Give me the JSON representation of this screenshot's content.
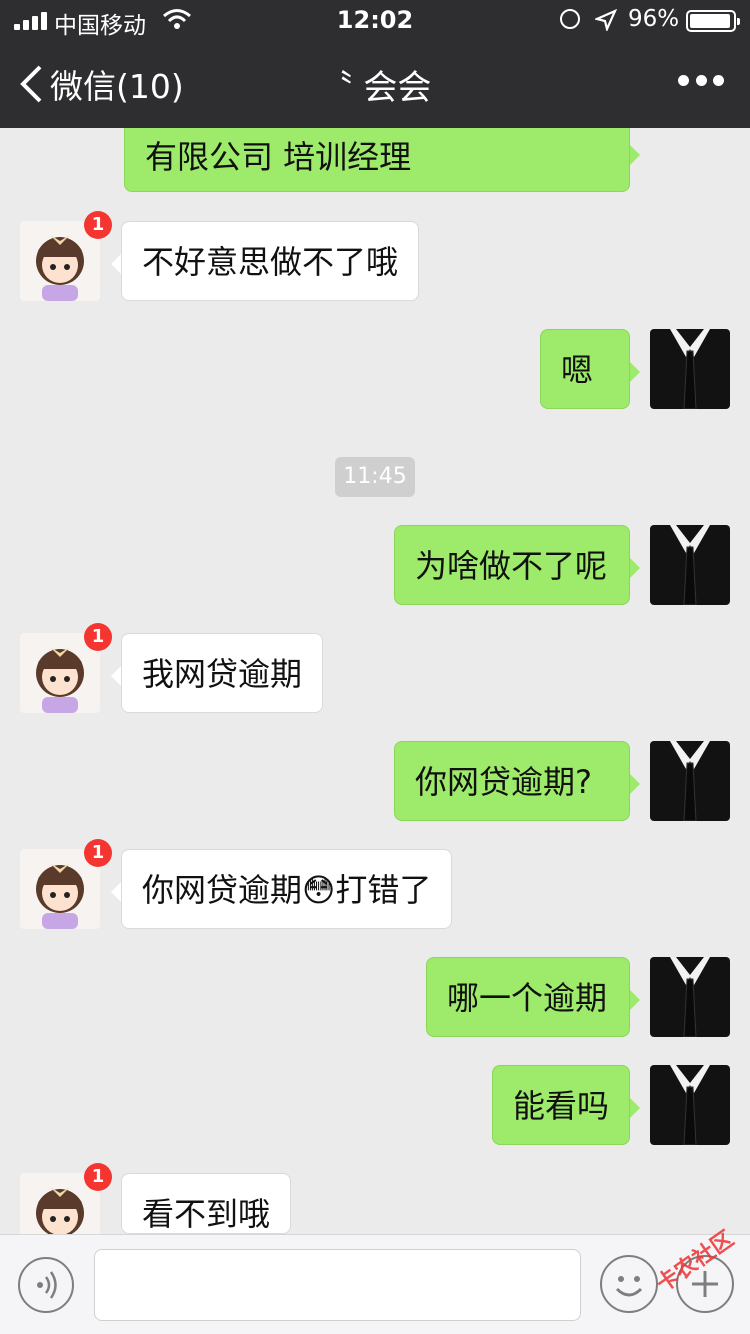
{
  "status_bar": {
    "carrier": "中国移动",
    "time": "12:02",
    "battery_percent": "96%"
  },
  "nav": {
    "back_label": "微信(10)",
    "title": "〝 会会"
  },
  "chat": {
    "timestamp": "11:45",
    "messages": [
      {
        "from": "me",
        "text": "有限公司  培训经理"
      },
      {
        "from": "them",
        "text": "不好意思做不了哦",
        "badge": "1"
      },
      {
        "from": "me",
        "text": "嗯"
      },
      {
        "from": "me",
        "text": "为啥做不了呢"
      },
      {
        "from": "them",
        "text": "我网贷逾期",
        "badge": "1"
      },
      {
        "from": "me",
        "text": "你网贷逾期?"
      },
      {
        "from": "them",
        "text": "你网贷逾期😳打错了",
        "badge": "1"
      },
      {
        "from": "me",
        "text": "哪一个逾期"
      },
      {
        "from": "me",
        "text": "能看吗"
      },
      {
        "from": "them",
        "text": "看不到哦",
        "badge": "1"
      }
    ]
  },
  "watermark": "卡农社区",
  "colors": {
    "nav_bg": "#2e2e30",
    "out_bubble": "#9eea6a",
    "in_bubble": "#ffffff",
    "badge": "#f43530"
  }
}
